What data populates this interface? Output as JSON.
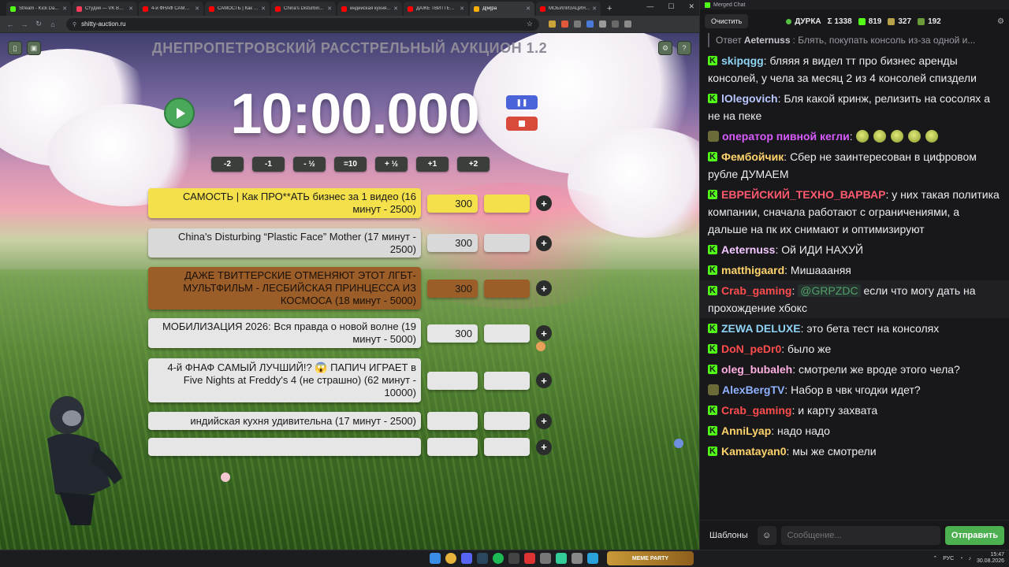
{
  "browser": {
    "tabs": [
      {
        "label": "Stream - Kick Da...",
        "color": "#53fc18"
      },
      {
        "label": "Студия — VK Вид...",
        "color": "#ff3b5c"
      },
      {
        "label": "4-й ФНАФ САМЫ...",
        "color": "#ff0000"
      },
      {
        "label": "САМОСТЬ | Как П...",
        "color": "#ff0000"
      },
      {
        "label": "China's Disturbin...",
        "color": "#ff0000"
      },
      {
        "label": "индийская кухня...",
        "color": "#ff0000"
      },
      {
        "label": "ДАЖЕ ТВИТТЕРС...",
        "color": "#ff0000"
      },
      {
        "label": "Д[м]ра",
        "color": "#ffb000",
        "active": true
      },
      {
        "label": "МОБИЛИЗАЦИЯ...",
        "color": "#ff0000"
      }
    ],
    "new_tab": "+",
    "url": "shitty-auction.ru"
  },
  "auction": {
    "title": "ДНЕПРОПЕТРОВСКИЙ РАССТРЕЛЬНЫЙ АУКЦИОН 1.2",
    "timer": "10:00.000",
    "adjust_buttons": [
      "-2",
      "-1",
      "- ½",
      "=10",
      "+ ½",
      "+1",
      "+2"
    ],
    "lots": [
      {
        "name": "САМОСТЬ | Как ПРО**АТЬ бизнес за 1 видео (16 минут - 2500)",
        "amount": "300",
        "color": "#f4e04a",
        "amount_color": "#f4e04a"
      },
      {
        "name": "China's Disturbing “Plastic Face” Mother (17 минут - 2500)",
        "amount": "300",
        "color": "#d9d9d9",
        "amount_color": "#d9d9d9"
      },
      {
        "name": "ДАЖЕ ТВИТТЕРСКИЕ ОТМЕНЯЮТ ЭТОТ ЛГБТ-МУЛЬТФИЛЬМ - ЛЕСБИЙСКАЯ ПРИНЦЕССА ИЗ КОСМОСА (18 минут - 5000)",
        "amount": "300",
        "color": "#9c5e28",
        "amount_color": "#9c5e28"
      },
      {
        "name": "МОБИЛИЗАЦИЯ 2026: Вся правда о новой волне (19 минут - 5000)",
        "amount": "300",
        "color": "#e6e6e6",
        "amount_color": "#e6e6e6"
      },
      {
        "name": "4-й ФНАФ САМЫЙ ЛУЧШИЙ!? 😱 ПАПИЧ ИГРАЕТ в Five Nights at Freddy's 4 (не страшно) (62 минут - 10000)",
        "amount": "",
        "color": "#e6e6e6",
        "amount_color": "#e6e6e6"
      },
      {
        "name": "индийская кухня удивительна (17 минут - 2500)",
        "amount": "",
        "color": "#e6e6e6",
        "amount_color": "#e6e6e6"
      },
      {
        "name": "",
        "amount": "",
        "color": "#e6e6e6",
        "amount_color": "#e6e6e6"
      }
    ],
    "plus_label": "+"
  },
  "chat": {
    "window_title": "Merged Chat",
    "clear_button": "Очистить",
    "channel": "ДУРКА",
    "stats": {
      "sigma": "Σ 1338",
      "kick": "819",
      "other1": "327",
      "other2": "192"
    },
    "reply": {
      "prefix": "Ответ",
      "user": "Aeternuss",
      "text": ": Блять, покупать консоль из-за одной и..."
    },
    "messages": [
      {
        "user": "skipqgg",
        "color": "#8fd3f4",
        "text": "бляяя я видел тт про бизнес аренды консолей, у чела за месяц 2 из 4 консолей спиздели",
        "badge": "kick"
      },
      {
        "user": "lOlegovich",
        "color": "#b8c7ff",
        "text": "Бля какой кринж, релизить на сосолях а не на пеке",
        "badge": "kick"
      },
      {
        "user": "оператор пивной кегли",
        "color": "#d95bff",
        "text": "",
        "badge": "avatar",
        "emotes": 5
      },
      {
        "user": "Фембойчик",
        "color": "#ffd36b",
        "text": "Сбер не заинтересован в цифровом рубле ДУМАЕМ",
        "badge": "kick"
      },
      {
        "user": "ЕВРЕЙСКИЙ_ТЕХНО_ВАРВАР",
        "color": "#ff5a6e",
        "text": "у них такая политика компании, сначала работают с ограничениями, а дальше на пк их снимают и оптимизируют",
        "badge": "kick"
      },
      {
        "user": "Aeternuss",
        "color": "#f3c6ff",
        "text": "Ой ИДИ НАХУЙ",
        "badge": "kick"
      },
      {
        "user": "matthigaard",
        "color": "#ffd36b",
        "text": "Мишаааняя",
        "badge": "kick"
      },
      {
        "user": "Crab_gaming",
        "color": "#ff4d4d",
        "text": "если что могу дать на прохождение хбокс",
        "mention": "@GRPZDC",
        "badge": "kick",
        "highlight": true
      },
      {
        "user": "ZEWA DELUXE",
        "color": "#8fd3f4",
        "text": "это бета тест на консолях",
        "badge": "kick"
      },
      {
        "user": "DoN_peDr0",
        "color": "#ff4d4d",
        "text": "было же",
        "badge": "kick"
      },
      {
        "user": "oleg_bubaleh",
        "color": "#ffb0e0",
        "text": "смотрели же вроде этого чела?",
        "badge": "kick"
      },
      {
        "user": "AlexBergTV",
        "color": "#8fb3ff",
        "text": "Набор в чвк чгодки идет?",
        "badge": "avatar"
      },
      {
        "user": "Crab_gaming",
        "color": "#ff4d4d",
        "text": "и карту захвата",
        "badge": "kick"
      },
      {
        "user": "AnniLyap",
        "color": "#ffd36b",
        "text": "надо надо",
        "badge": "kick"
      },
      {
        "user": "Kamatayan0",
        "color": "#ffd36b",
        "text": "мы же смотрели",
        "badge": "kick"
      }
    ],
    "templates_button": "Шаблоны",
    "input_placeholder": "Сообщение...",
    "send_button": "Отправить"
  },
  "taskbar": {
    "widget": "МЕМЕ PARTY",
    "lang": "РУС",
    "time": "15:47",
    "date": "30.08.2026"
  }
}
